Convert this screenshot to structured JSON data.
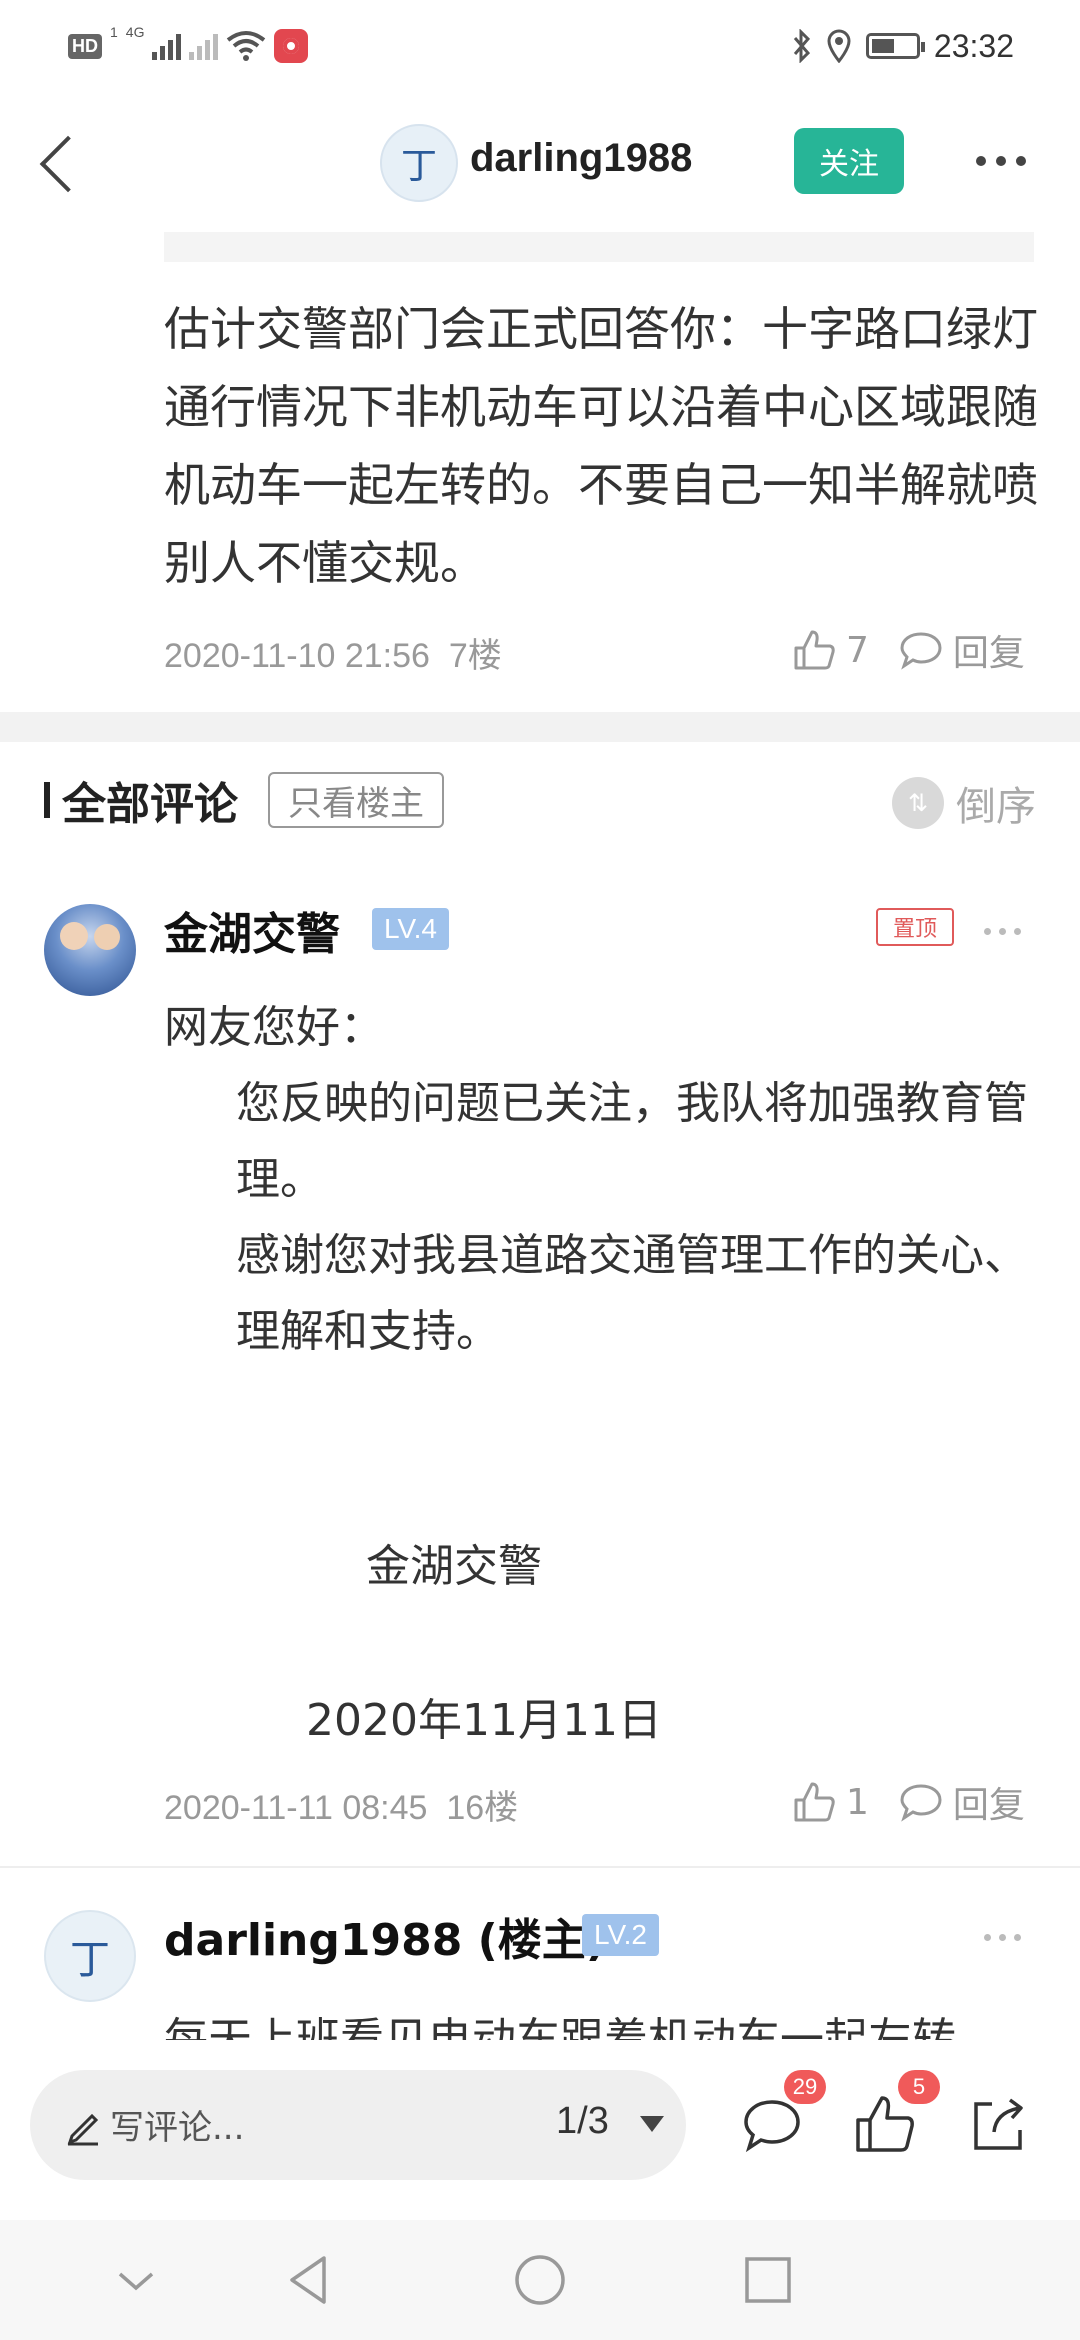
{
  "status_bar": {
    "left_hd": "HD",
    "left_sim": "1",
    "left_net": "4G",
    "time": "23:32"
  },
  "header": {
    "username": "darling1988",
    "follow_label": "关注"
  },
  "post": {
    "text": "估计交警部门会正式回答你：十字路口绿灯通行情况下非机动车可以沿着中心区域跟随机动车一起左转的。不要自己一知半解就喷别人不懂交规。",
    "time": "2020-11-10 21:56",
    "floor": "7楼",
    "likes": "7",
    "reply_label": "回复"
  },
  "comments_header": {
    "title": "全部评论",
    "op_only_label": "只看楼主",
    "sort_label": "倒序"
  },
  "comments": [
    {
      "name": "金湖交警",
      "level": "LV.4",
      "pinned_label": "置顶",
      "greeting": "网友您好：",
      "para1": "您反映的问题已关注，我队将加强教育管理。",
      "para2": "感谢您对我县道路交通管理工作的关心、理解和支持。",
      "signature": "金湖交警",
      "date": "2020年11月11日",
      "time": "2020-11-11 08:45",
      "floor": "16楼",
      "likes": "1",
      "reply_label": "回复"
    },
    {
      "name": "darling1988 (楼主)",
      "level": "LV.2",
      "text_partial": "每天上班看见电动车跟着机动车一起左转"
    }
  ],
  "bottom_bar": {
    "input_placeholder": "写评论...",
    "page_indicator": "1/3",
    "comment_count": "29",
    "like_count": "5"
  },
  "icons": [
    "back-icon",
    "more-icon",
    "thumb-up-icon",
    "comment-bubble-icon",
    "sort-icon",
    "pen-icon",
    "share-icon",
    "nav-down-icon",
    "nav-back-icon",
    "nav-home-icon",
    "nav-recent-icon"
  ],
  "colors": {
    "accent_green": "#27b597",
    "badge_red": "#f05a5a",
    "level_blue": "#9fc2ec"
  }
}
